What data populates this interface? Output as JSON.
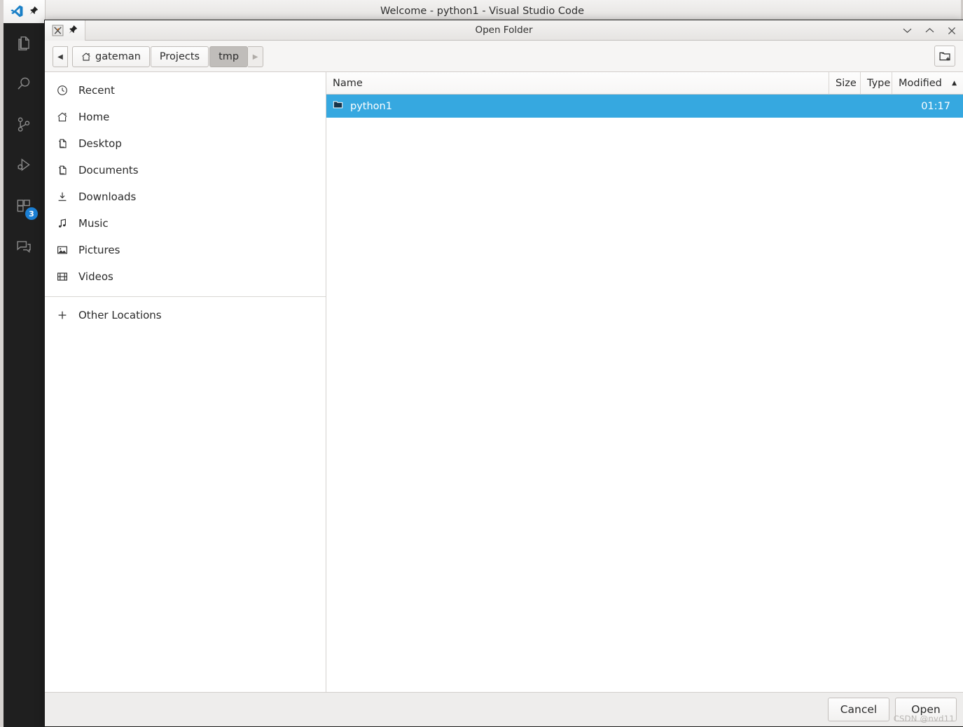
{
  "window": {
    "title": "Welcome - python1 - Visual Studio Code",
    "logo_icon": "vscode-logo-icon",
    "pin_icon": "pin-icon"
  },
  "activity_bar": {
    "items": [
      {
        "name": "explorer",
        "icon": "files-icon",
        "badge": ""
      },
      {
        "name": "search",
        "icon": "search-icon",
        "badge": ""
      },
      {
        "name": "source-control",
        "icon": "source-control-icon",
        "badge": ""
      },
      {
        "name": "run-and-debug",
        "icon": "run-debug-icon",
        "badge": ""
      },
      {
        "name": "extensions",
        "icon": "extensions-icon",
        "badge": "3"
      },
      {
        "name": "comments",
        "icon": "comment-icon",
        "badge": ""
      }
    ],
    "badge_color": "#1b7fd4"
  },
  "dialog": {
    "title": "Open Folder",
    "app_icon": "x-application-icon",
    "pin_icon": "pin-icon",
    "window_controls": {
      "minimize": "minimize-icon",
      "maximize": "maximize-icon",
      "close": "close-icon"
    },
    "pathbar": {
      "back_arrow": "◀",
      "forward_arrow": "▶",
      "crumbs": [
        {
          "label": "gateman",
          "icon": "home-icon",
          "active": false
        },
        {
          "label": "Projects",
          "icon": "",
          "active": false
        },
        {
          "label": "tmp",
          "icon": "",
          "active": true
        }
      ]
    },
    "new_folder_button": "create-folder-icon",
    "places": {
      "items": [
        {
          "label": "Recent",
          "icon": "clock-icon"
        },
        {
          "label": "Home",
          "icon": "home-icon"
        },
        {
          "label": "Desktop",
          "icon": "document-icon"
        },
        {
          "label": "Documents",
          "icon": "document-icon"
        },
        {
          "label": "Downloads",
          "icon": "download-icon"
        },
        {
          "label": "Music",
          "icon": "music-note-icon"
        },
        {
          "label": "Pictures",
          "icon": "picture-icon"
        },
        {
          "label": "Videos",
          "icon": "film-icon"
        }
      ],
      "other_locations": {
        "label": "Other Locations",
        "icon": "plus-icon"
      }
    },
    "file_list": {
      "columns": {
        "name": "Name",
        "size": "Size",
        "type": "Type",
        "modified": "Modified"
      },
      "sort_column": "Modified",
      "sort_caret": "▲",
      "rows": [
        {
          "icon": "folder-icon",
          "name": "python1",
          "size": "",
          "type": "",
          "modified": "01:17",
          "selected": true
        }
      ],
      "selection_color": "#36a8e0"
    },
    "footer": {
      "cancel_label": "Cancel",
      "open_label": "Open"
    }
  },
  "watermark": "CSDN @nvd11"
}
